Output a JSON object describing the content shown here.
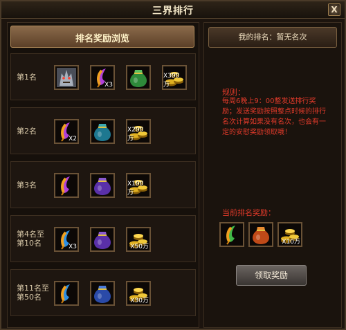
{
  "window": {
    "title": "三界排行",
    "close_glyph": "X"
  },
  "left": {
    "banner": "排名奖励浏览",
    "rows": [
      {
        "rank": "第1名",
        "items": [
          {
            "icon": "monster-portrait-icon",
            "count": ""
          },
          {
            "icon": "purple-feather-icon",
            "count": "X3"
          },
          {
            "icon": "green-bag-icon",
            "count": ""
          },
          {
            "icon": "gold-coins-icon",
            "count": "X300万"
          }
        ]
      },
      {
        "rank": "第2名",
        "items": [
          {
            "icon": "purple-feather-icon",
            "count": "X2"
          },
          {
            "icon": "teal-bag-icon",
            "count": ""
          },
          {
            "icon": "gold-coins-icon",
            "count": "X200万"
          }
        ]
      },
      {
        "rank": "第3名",
        "items": [
          {
            "icon": "purple-feather-icon",
            "count": ""
          },
          {
            "icon": "purple-bag-icon",
            "count": ""
          },
          {
            "icon": "gold-coins-icon",
            "count": "X100万"
          }
        ]
      },
      {
        "rank": "第4名至第10名",
        "items": [
          {
            "icon": "blue-feather-icon",
            "count": "X3"
          },
          {
            "icon": "purple-bag-icon",
            "count": ""
          },
          {
            "icon": "gold-coins-icon",
            "count": "X50万"
          }
        ]
      },
      {
        "rank": "第11名至第50名",
        "items": [
          {
            "icon": "blue-feather-icon",
            "count": ""
          },
          {
            "icon": "blue-bag-icon",
            "count": ""
          },
          {
            "icon": "gold-coins-icon",
            "count": "X30万"
          }
        ]
      }
    ]
  },
  "right": {
    "my_rank": "我的排名：暂无名次",
    "rules_title": "规则：",
    "rules_text": "每周6晚上9：00整发送排行奖励；发送奖励按照整点时候的排行名次计算如果没有名次，也会有一定的安慰奖励领取哦！",
    "current_label": "当前排名奖励：",
    "current_items": [
      {
        "icon": "green-feather-icon",
        "count": ""
      },
      {
        "icon": "orange-bag-icon",
        "count": ""
      },
      {
        "icon": "gold-coins-icon",
        "count": "X10万"
      }
    ],
    "claim_button": "领取奖励"
  },
  "colors": {
    "red_text": "#e03a2a",
    "frame": "#6a5236",
    "banner": "#8a6a4a"
  }
}
